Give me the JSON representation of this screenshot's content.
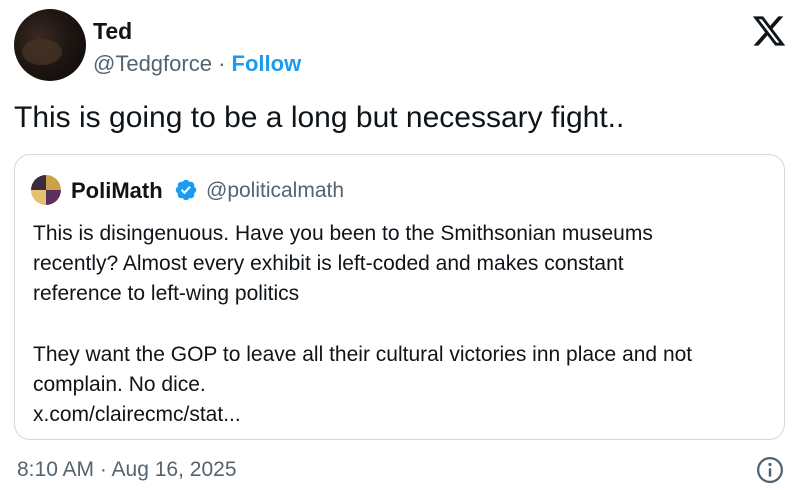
{
  "author": {
    "name": "Ted",
    "handle": "@Tedgforce",
    "separator": "·",
    "follow_label": "Follow"
  },
  "tweet": {
    "text": "This is going to be a long but necessary fight.."
  },
  "quoted_tweet": {
    "name": "PoliMath",
    "handle": "@politicalmath",
    "verified": true,
    "paragraph1": [
      "This is disingenuous. Have you been to the Smithsonian museums",
      "recently? Almost every exhibit is left-coded and makes constant",
      "reference to left-wing politics"
    ],
    "paragraph2": [
      "They want the GOP to leave all their cultural victories inn place and not",
      "complain. No dice.",
      "x.com/clairecmc/stat..."
    ]
  },
  "footer": {
    "timestamp": "8:10 AM · Aug 16, 2025"
  },
  "icons": {
    "brand": "x-logo-icon",
    "verified": "verified-badge-icon",
    "info": "info-icon"
  },
  "colors": {
    "follow": "#1d9bf0",
    "verified": "#1d9bf0",
    "secondary_text": "#536471",
    "border": "#cfd9de"
  }
}
